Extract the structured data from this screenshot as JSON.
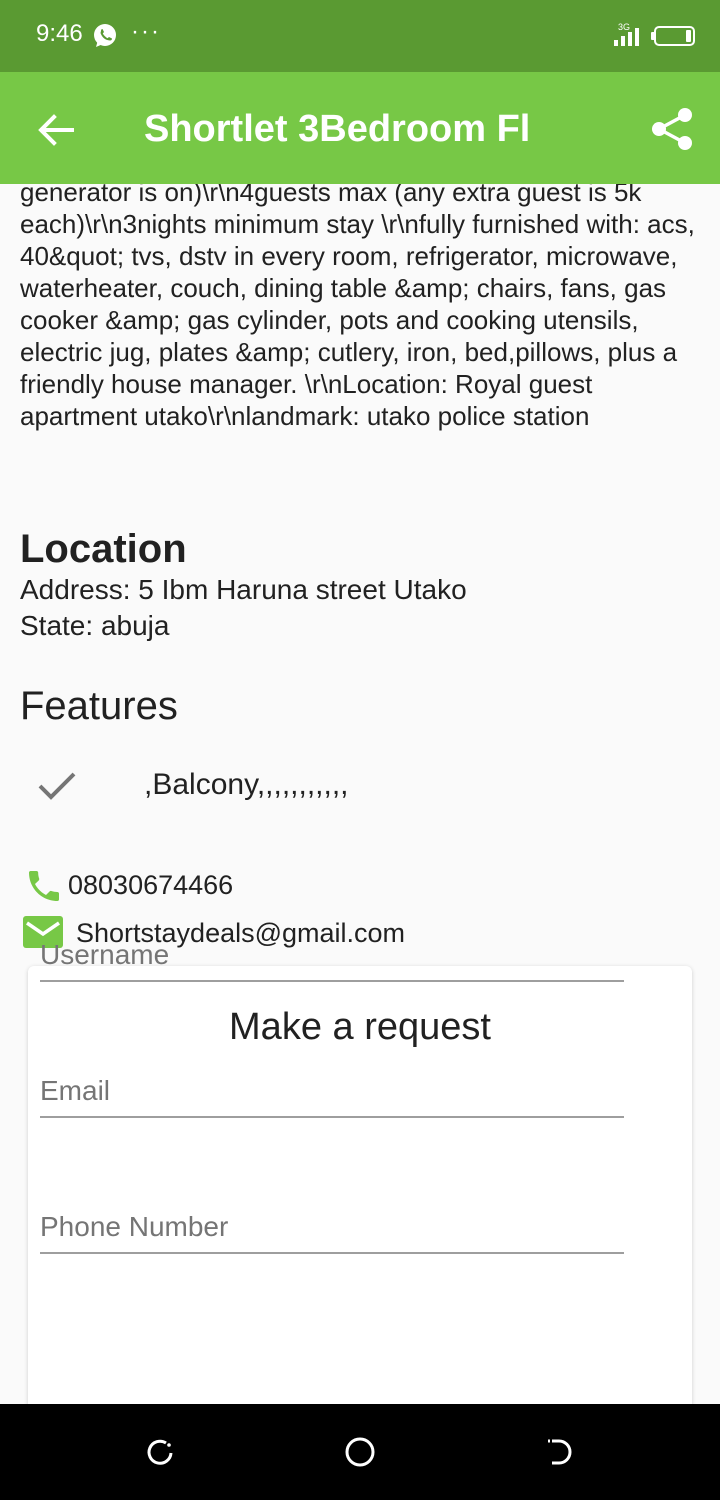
{
  "status_bar": {
    "time": "9:46",
    "dots": "···",
    "icons": [
      "whatsapp-icon",
      "signal-3g-icon",
      "battery-icon"
    ]
  },
  "app_bar": {
    "title": "Shortlet 3Bedroom Fl",
    "background": "#77c846",
    "status_background": "#5a9a32"
  },
  "description": "generator is on)\\r\\n4guests max (any extra guest is 5k each)\\r\\n3nights minimum stay \\r\\nfully furnished with: acs, 40&quot; tvs, dstv in every room, refrigerator, microwave, waterheater, couch, dining table &amp; chairs, fans, gas cooker &amp; gas cylinder, pots and cooking utensils, electric jug, plates &amp; cutlery, iron, bed,pillows, plus a friendly house manager. \\r\\nLocation: Royal guest apartment utako\\r\\nlandmark: utako police station",
  "location": {
    "heading": "Location",
    "address": "Address: 5 Ibm Haruna street  Utako",
    "state": "State: abuja"
  },
  "features": {
    "heading": "Features",
    "items": [
      ",Balcony,,,,,,,,,,,"
    ]
  },
  "contact": {
    "phone": "08030674466",
    "email": "Shortstaydeals@gmail.com",
    "accent": "#77c846"
  },
  "request_form": {
    "title": "Make a request",
    "username_placeholder": "Username",
    "email_placeholder": "Email",
    "phone_placeholder": "Phone Number"
  }
}
